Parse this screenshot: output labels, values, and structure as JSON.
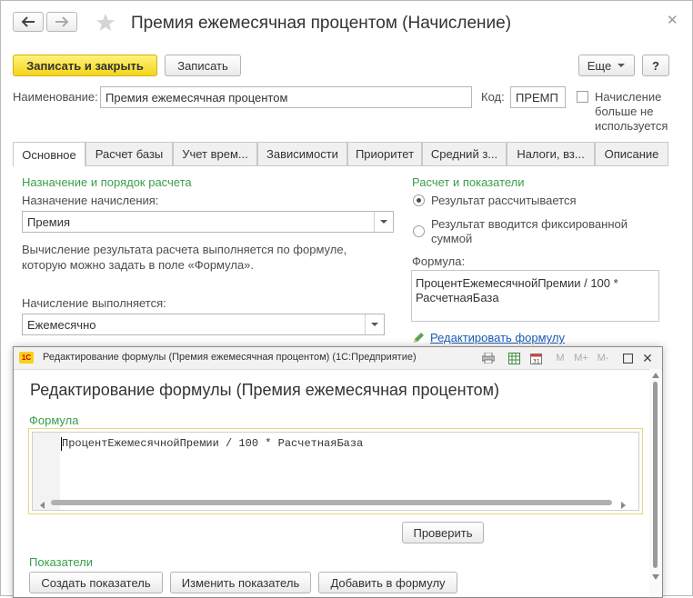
{
  "window": {
    "title": "Премия ежемесячная процентом (Начисление)"
  },
  "toolbar": {
    "save_close_label": "Записать и закрыть",
    "save_label": "Записать",
    "more_label": "Еще",
    "help_label": "?"
  },
  "form": {
    "name_label": "Наименование:",
    "name_value": "Премия ежемесячная процентом",
    "code_label": "Код:",
    "code_value": "ПРЕМП",
    "unused_label_line1": "Начисление",
    "unused_label_line2": "больше не",
    "unused_label_line3": "используется"
  },
  "tabs": [
    {
      "label": "Основное"
    },
    {
      "label": "Расчет базы"
    },
    {
      "label": "Учет врем..."
    },
    {
      "label": "Зависимости"
    },
    {
      "label": "Приоритет"
    },
    {
      "label": "Средний з..."
    },
    {
      "label": "Налоги, вз..."
    },
    {
      "label": "Описание"
    }
  ],
  "left": {
    "section_title": "Назначение и порядок расчета",
    "purpose_label": "Назначение начисления:",
    "purpose_value": "Премия",
    "info_line1": "Вычисление результата расчета выполняется по формуле,",
    "info_line2": "которую можно задать в поле «Формула».",
    "period_label": "Начисление выполняется:",
    "period_value": "Ежемесячно"
  },
  "right": {
    "section_title": "Расчет и показатели",
    "radio1_label": "Результат рассчитывается",
    "radio2_line1": "Результат вводится фиксированной",
    "radio2_line2": "суммой",
    "formula_label": "Формула:",
    "formula_line1": "ПроцентЕжемесячнойПремии / 100 *",
    "formula_line2": "РасчетнаяБаза",
    "edit_formula_link": "Редактировать формулу"
  },
  "modal": {
    "titlebar_text": "Редактирование формулы (Премия ежемесячная процентом)  (1С:Предприятие)",
    "heading": "Редактирование формулы (Премия ежемесячная процентом)",
    "formula_section": "Формула",
    "formula_text": "ПроцентЕжемесячнойПремии / 100 * РасчетнаяБаза",
    "check_button": "Проверить",
    "indicators_section": "Показатели",
    "create_indicator_button": "Создать показатель",
    "change_indicator_button": "Изменить показатель",
    "add_to_formula_button": "Добавить в формулу",
    "tb_m": "M",
    "tb_mplus": "M+",
    "tb_mminus": "M-",
    "logo_text": "1С"
  },
  "colors": {
    "accent_yellow": "#f4d51b",
    "section_green": "#3a9e4b",
    "link_blue": "#1a5bb5",
    "formula_border": "#e6d77a"
  }
}
